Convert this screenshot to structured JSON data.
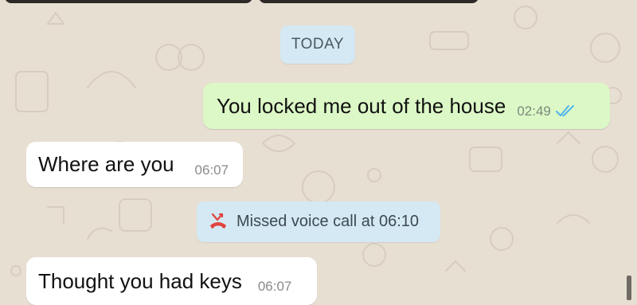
{
  "date_divider": {
    "label": "TODAY"
  },
  "messages": [
    {
      "direction": "outgoing",
      "text": "You locked me out of the house",
      "time": "02:49",
      "status": "read"
    },
    {
      "direction": "incoming",
      "text": "Where are you",
      "time": "06:07"
    },
    {
      "direction": "incoming",
      "text": "Thought you had keys",
      "time": "06:07"
    }
  ],
  "system_events": [
    {
      "icon": "missed-call-icon",
      "text": "Missed voice call at 06:10"
    }
  ],
  "colors": {
    "wallpaper": "#e8dfd3",
    "outgoing_bubble": "#dcf8c6",
    "incoming_bubble": "#ffffff",
    "info_pill": "#d4e9f3",
    "read_ticks": "#4fb6ec",
    "missed_call": "#e0443e"
  }
}
